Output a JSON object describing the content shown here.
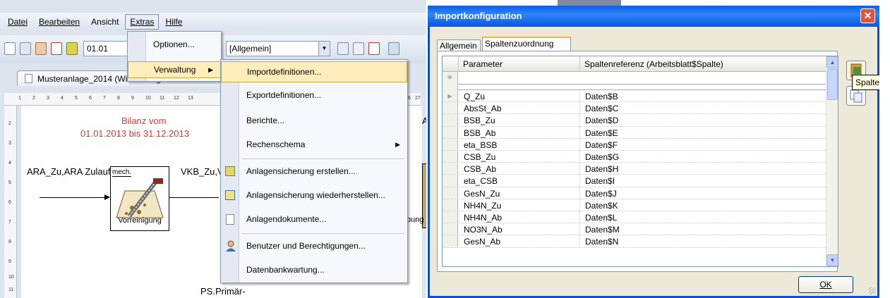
{
  "menubar": {
    "items": [
      "Datei",
      "Bearbeiten",
      "Ansicht",
      "Extras",
      "Hilfe"
    ]
  },
  "toolbar": {
    "zoom_value": "01.01",
    "style_value": "[Allgemein]"
  },
  "document_tab": {
    "label": "Musteranlage_2014 (Wiedemergestellt am 11.08"
  },
  "ruler": {
    "top": [
      "1",
      "2",
      "3",
      "4",
      "5",
      "6",
      "7",
      "8",
      "9",
      "10",
      "11",
      "12",
      "13"
    ],
    "top_right": [
      "6",
      "27"
    ],
    "left": [
      "2",
      "3",
      "4",
      "5",
      "6",
      "7",
      "8",
      "9",
      "10",
      "11"
    ]
  },
  "canvas": {
    "bilanz_line1": "Bilanz vom",
    "bilanz_line2": "01.01.2013 bis 31.12.2013",
    "flow_in": "ARA_Zu,ARA Zulauf",
    "flow_out": "VKB_Zu,V",
    "vor_tag": "mech.",
    "vor_label": "Vorreinigung",
    "right_fragment": "A",
    "right_fragment2": "bung",
    "bottom_fragment": "PS.Primär-"
  },
  "extras_menu": {
    "items": [
      {
        "label": "Optionen..."
      },
      {
        "label": "Verwaltung",
        "has_submenu": true
      }
    ]
  },
  "verwaltung_menu": {
    "items": [
      {
        "label": "Importdefinitionen..."
      },
      {
        "label": "Exportdefinitionen..."
      },
      {
        "label": "Berichte..."
      },
      {
        "label": "Rechenschema",
        "has_submenu": true
      },
      {
        "label": "Anlagensicherung erstellen..."
      },
      {
        "label": "Anlagensicherung wiederherstellen..."
      },
      {
        "label": "Anlagendokumente..."
      },
      {
        "label": "Benutzer und Berechtigungen..."
      },
      {
        "label": "Datenbankwartung..."
      }
    ]
  },
  "dialog": {
    "title": "Importkonfiguration",
    "close_glyph": "✕",
    "tabs": [
      "Allgemein",
      "Spaltenzuordnung"
    ],
    "columns": [
      "Parameter",
      "Spaltenreferenz (Arbeitsblatt$Spalte)"
    ],
    "rows": [
      {
        "param": "Q_Zu",
        "ref": "Daten$B"
      },
      {
        "param": "AbsSt_Ab",
        "ref": "Daten$C"
      },
      {
        "param": "BSB_Zu",
        "ref": "Daten$D"
      },
      {
        "param": "BSB_Ab",
        "ref": "Daten$E"
      },
      {
        "param": "eta_BSB",
        "ref": "Daten$F"
      },
      {
        "param": "CSB_Zu",
        "ref": "Daten$G"
      },
      {
        "param": "CSB_Ab",
        "ref": "Daten$H"
      },
      {
        "param": "eta_CSB",
        "ref": "Daten$I"
      },
      {
        "param": "GesN_Zu",
        "ref": "Daten$J"
      },
      {
        "param": "NH4N_Zu",
        "ref": "Daten$K"
      },
      {
        "param": "NH4N_Ab",
        "ref": "Daten$L"
      },
      {
        "param": "NO3N_Ab",
        "ref": "Daten$M"
      },
      {
        "param": "GesN_Ab",
        "ref": "Daten$N"
      }
    ],
    "tooltip": "Spalte",
    "ok_label": "OK"
  }
}
